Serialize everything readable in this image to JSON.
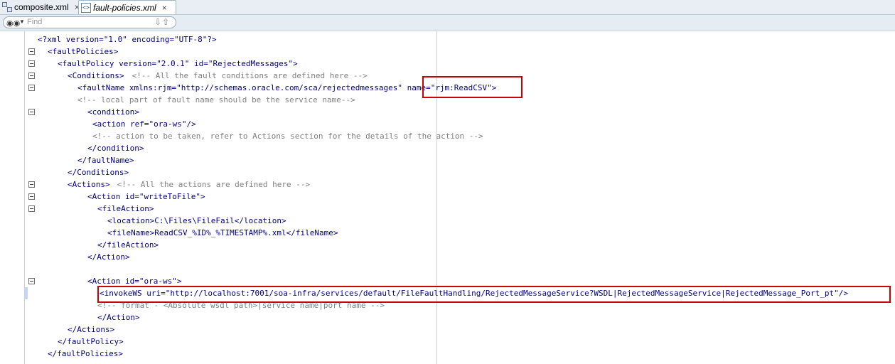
{
  "tabs": [
    {
      "label": "composite.xml",
      "close": "×",
      "icon": "composite-icon"
    },
    {
      "label": "fault-policies.xml",
      "close": "×",
      "icon": "xml-file-icon"
    }
  ],
  "find": {
    "placeholder": "Find"
  },
  "lines": {
    "l1": "<?xml version=\"1.0\" encoding=\"UTF-8\"?>",
    "l2": "<faultPolicies>",
    "l3": "<faultPolicy version=\"2.0.1\" id=\"RejectedMessages\">",
    "l4a": "<Conditions>",
    "l4b": " <!-- All the fault conditions are defined here -->",
    "l5": "<faultName xmlns:rjm=\"http://schemas.oracle.com/sca/rejectedmessages\" name=\"rjm:ReadCSV\">",
    "l6": "<!-- local part of fault name should be the service name-->",
    "l7": "<condition>",
    "l8": "<action ref=\"ora-ws\"/>",
    "l9": "<!-- action to be taken, refer to Actions section for the details of the action -->",
    "l10": "</condition>",
    "l11": "</faultName>",
    "l12": "</Conditions>",
    "l13a": "<Actions>",
    "l13b": " <!-- All the actions are defined here -->",
    "l14": "<Action id=\"writeToFile\">",
    "l15": "<fileAction>",
    "l16": "<location>C:\\Files\\FileFail</location>",
    "l17": "<fileName>ReadCSV_%ID%_%TIMESTAMP%.xml</fileName>",
    "l18": "</fileAction>",
    "l19": "</Action>",
    "l21": "<Action id=\"ora-ws\">",
    "l22": "<invokeWS uri=\"http://localhost:7001/soa-infra/services/default/FileFaultHandling/RejectedMessageService?WSDL|RejectedMessageService|RejectedMessage_Port_pt\"/>",
    "l23": "<!-- format - <Absolute wsdl path>|service name|port name -->",
    "l24": "</Action>",
    "l25": "</Actions>",
    "l26": "</faultPolicy>",
    "l27": "</faultPolicies>"
  }
}
